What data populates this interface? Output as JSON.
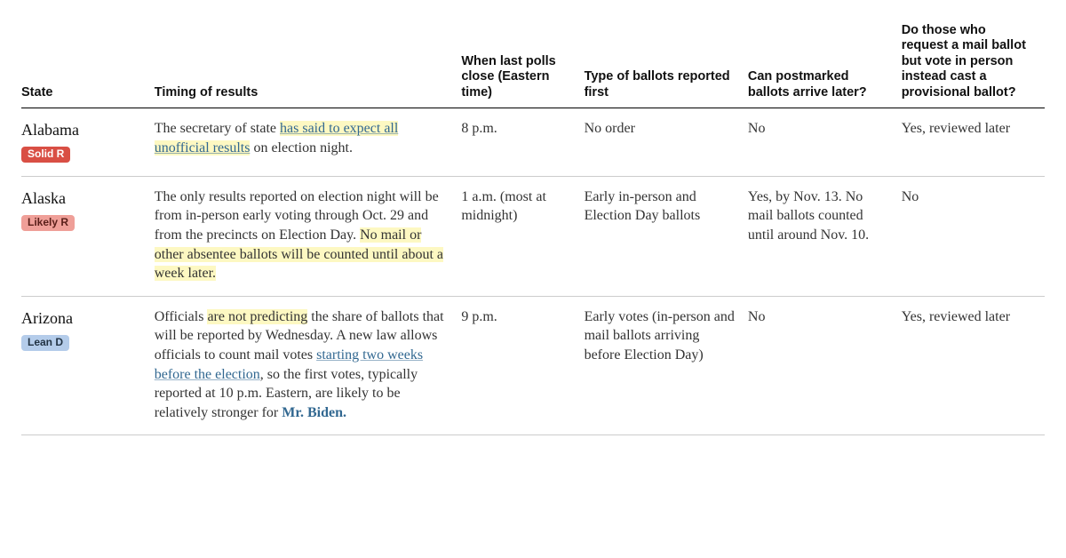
{
  "headers": {
    "state": "State",
    "timing": "Timing of results",
    "polls_close": "When last polls close (Eastern time)",
    "ballots_first": "Type of ballots reported first",
    "postmarked": "Can postmarked ballots arrive later?",
    "provisional": "Do those who request a mail ballot but vote in person instead cast a provisional ballot?"
  },
  "rows": [
    {
      "state": "Alabama",
      "badge": "Solid R",
      "badge_class": "badge-solid-r",
      "timing": {
        "pre1": "The secretary of state ",
        "link1": "has said to expect all unofficial results",
        "post1": " on election night."
      },
      "polls_close": "8 p.m.",
      "ballots_first": "No order",
      "postmarked": "No",
      "provisional": "Yes, reviewed later"
    },
    {
      "state": "Alaska",
      "badge": "Likely R",
      "badge_class": "badge-likely-r",
      "timing": {
        "pre1": "The only results reported on election night will be from in-person early voting through Oct. 29 and from the precincts on Election Day. ",
        "hl1": "No mail or other absentee ballots will be counted until about a week later."
      },
      "polls_close": "1 a.m. (most at midnight)",
      "ballots_first": "Early in-person and Election Day ballots",
      "postmarked": "Yes, by Nov. 13. No mail ballots counted until around Nov. 10.",
      "provisional": "No"
    },
    {
      "state": "Arizona",
      "badge": "Lean D",
      "badge_class": "badge-lean-d",
      "timing": {
        "pre1": "Officials ",
        "hl1": "are not predicting",
        "mid1": " the share of ballots that will be reported by Wednesday. A new law allows officials to count mail votes ",
        "link1": "starting two weeks before the election",
        "mid2": ", so the first votes, typically reported at 10 p.m. Eastern, are likely to be relatively stronger for ",
        "boldlink": "Mr. Biden."
      },
      "polls_close": "9 p.m.",
      "ballots_first": "Early votes (in-person and mail ballots arriving before Election Day)",
      "postmarked": "No",
      "provisional": "Yes, reviewed later"
    }
  ]
}
